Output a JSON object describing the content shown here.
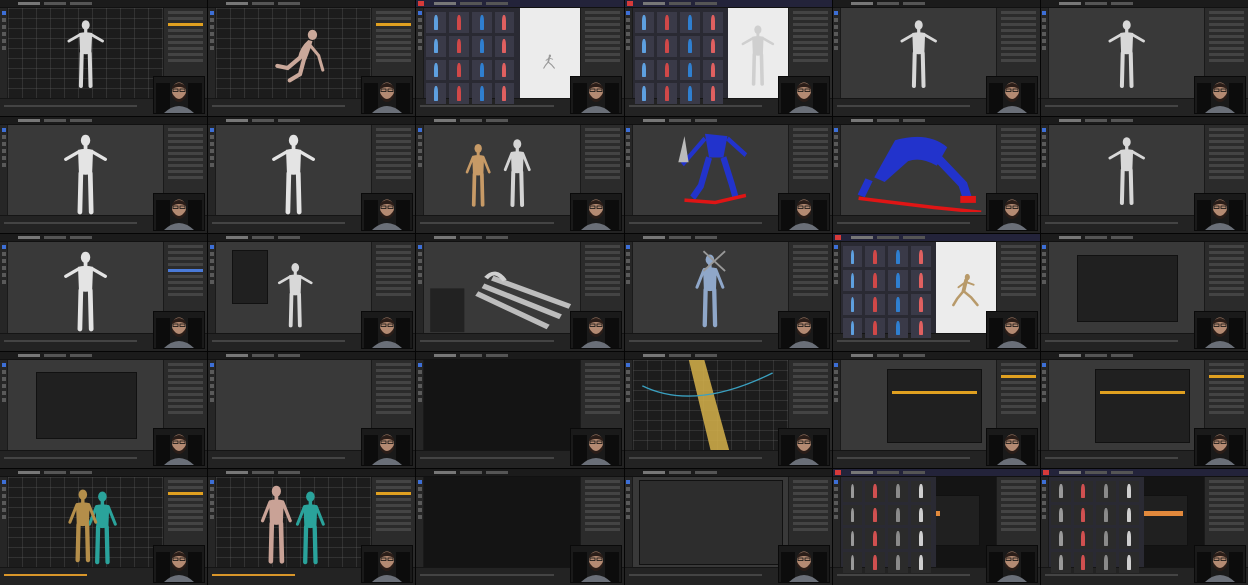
{
  "screen": {
    "title": "",
    "columns": 6,
    "rows": 5
  },
  "colors": {
    "accent": "#e0a020",
    "select_blue": "#3d6fd6",
    "mixamo_red": "#d63a3a",
    "rig_blue": "#2233cc",
    "rig_red": "#e01515",
    "skin": "#d8d8d8"
  },
  "tiles": [
    {
      "theme": "blender",
      "view": "grid-bg",
      "content": "figure-small",
      "webcam": true,
      "icon": "tpose-figure-icon"
    },
    {
      "theme": "blender",
      "view": "grid-bg",
      "content": "figure-kneel",
      "webcam": true,
      "icon": "kneeling-figure-icon"
    },
    {
      "theme": "mixamo",
      "view": "light",
      "content": "mixamo-small",
      "webcam": true,
      "icon": "mixamo-character-icon"
    },
    {
      "theme": "mixamo",
      "view": "light",
      "content": "mixamo-run",
      "webcam": true,
      "icon": "running-figure-icon"
    },
    {
      "theme": "blender",
      "view": "normal",
      "content": "figure-tpose-orbit",
      "webcam": true,
      "icon": "tpose-figure-icon"
    },
    {
      "theme": "blender",
      "view": "normal",
      "content": "figure-tpose",
      "webcam": true,
      "icon": "tpose-figure-icon"
    },
    {
      "theme": "blender",
      "view": "normal",
      "content": "figure-large",
      "webcam": true,
      "icon": "body-mesh-icon"
    },
    {
      "theme": "blender",
      "view": "normal",
      "content": "figure-large",
      "webcam": true,
      "icon": "body-mesh-icon"
    },
    {
      "theme": "blender",
      "view": "normal",
      "content": "figure-rig",
      "webcam": true,
      "icon": "armature-icon"
    },
    {
      "theme": "blender",
      "view": "normal",
      "content": "rig-blue",
      "webcam": true,
      "icon": "rig-weights-icon"
    },
    {
      "theme": "blender",
      "view": "normal",
      "content": "rig-blue-lunge",
      "webcam": true,
      "icon": "rig-weights-icon"
    },
    {
      "theme": "blender",
      "view": "normal",
      "content": "figure-tpose",
      "webcam": true,
      "icon": "tpose-figure-icon"
    },
    {
      "theme": "blender",
      "view": "normal",
      "content": "figure-large-bones",
      "webcam": true,
      "icon": "body-mesh-icon"
    },
    {
      "theme": "blender",
      "view": "normal",
      "content": "figure-menu",
      "webcam": true,
      "icon": "context-menu-icon"
    },
    {
      "theme": "blender",
      "view": "normal",
      "content": "wireframe-objects",
      "webcam": true,
      "icon": "wireframe-icon"
    },
    {
      "theme": "blender",
      "view": "normal",
      "content": "robot",
      "webcam": true,
      "icon": "robot-figure-icon"
    },
    {
      "theme": "mixamo",
      "view": "light",
      "content": "mixamo-fight",
      "webcam": true,
      "icon": "fighting-figure-icon"
    },
    {
      "theme": "blender",
      "view": "normal",
      "content": "file-dialog",
      "webcam": true,
      "icon": "file-browser-icon"
    },
    {
      "theme": "blender",
      "view": "normal",
      "content": "dark-dialog",
      "webcam": true,
      "icon": "file-dialog-icon"
    },
    {
      "theme": "blender",
      "view": "normal",
      "content": "empty-view",
      "webcam": true,
      "icon": "viewport-icon"
    },
    {
      "theme": "dark",
      "view": "black",
      "content": "editor",
      "webcam": true,
      "icon": "editor-window-icon"
    },
    {
      "theme": "blender",
      "view": "grid-bg",
      "content": "light-cone",
      "webcam": true,
      "icon": "light-cone-icon"
    },
    {
      "theme": "blender",
      "view": "normal",
      "content": "props-list",
      "webcam": true,
      "icon": "properties-icon"
    },
    {
      "theme": "blender",
      "view": "normal",
      "content": "props-list",
      "webcam": true,
      "icon": "properties-icon"
    },
    {
      "theme": "blender",
      "view": "grid-bg",
      "content": "figure-cyan",
      "webcam": true,
      "icon": "skeleton-figure-icon"
    },
    {
      "theme": "blender",
      "view": "grid-bg",
      "content": "figure-cyan-nude",
      "webcam": true,
      "icon": "skeleton-figure-icon"
    },
    {
      "theme": "dark",
      "view": "black",
      "content": "editor",
      "webcam": true,
      "icon": "editor-window-icon"
    },
    {
      "theme": "blender",
      "view": "normal",
      "content": "scene-list",
      "webcam": true,
      "icon": "outliner-icon"
    },
    {
      "theme": "mixamo",
      "view": "black",
      "content": "mixamo-dark",
      "webcam": true,
      "icon": "mixamo-character-icon"
    },
    {
      "theme": "mixamo",
      "view": "black",
      "content": "mixamo-dark-orange",
      "webcam": true,
      "icon": "mixamo-character-icon"
    }
  ]
}
